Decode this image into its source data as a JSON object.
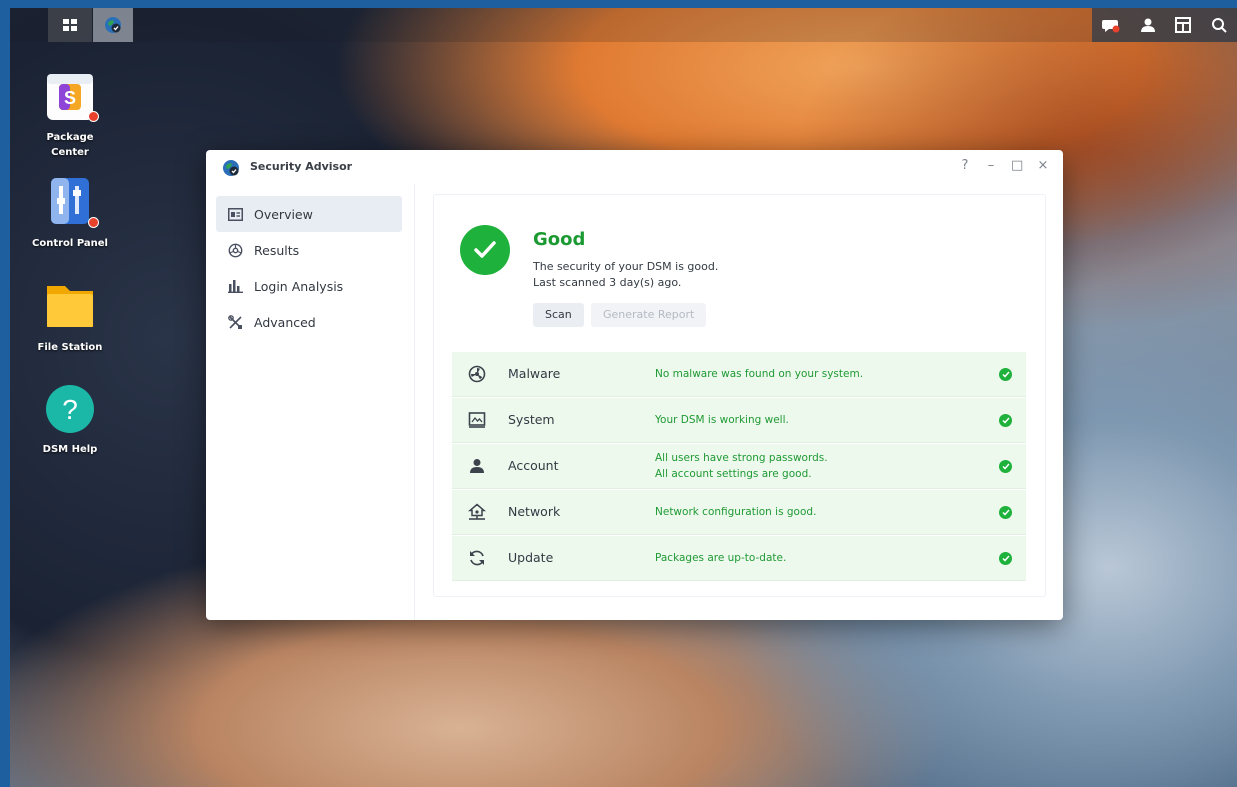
{
  "desktop": {
    "icons": [
      {
        "label": "Package\nCenter",
        "icon": "package-center-icon"
      },
      {
        "label": "Control Panel",
        "icon": "control-panel-icon"
      },
      {
        "label": "File Station",
        "icon": "file-station-icon"
      },
      {
        "label": "DSM Help",
        "icon": "dsm-help-icon"
      }
    ]
  },
  "taskbar": {
    "left": [
      "main-menu-icon",
      "security-advisor-taskbar-icon"
    ],
    "right": [
      "notifications-icon",
      "user-icon",
      "widgets-icon",
      "search-icon"
    ]
  },
  "window": {
    "title": "Security Advisor",
    "controls": {
      "help": "?",
      "minimize": "–",
      "maximize": "□",
      "close": "×"
    },
    "sidebar": [
      {
        "label": "Overview",
        "icon": "overview-icon",
        "selected": true
      },
      {
        "label": "Results",
        "icon": "results-icon"
      },
      {
        "label": "Login Analysis",
        "icon": "login-analysis-icon"
      },
      {
        "label": "Advanced",
        "icon": "advanced-icon"
      }
    ],
    "overview": {
      "status": "Good",
      "description": "The security of your DSM is good.",
      "last_scanned": "Last scanned 3 day(s) ago.",
      "scan_button": "Scan",
      "report_button": "Generate Report",
      "categories": [
        {
          "name": "Malware",
          "icon": "malware-icon",
          "message": "No malware was found on your system."
        },
        {
          "name": "System",
          "icon": "system-icon",
          "message": "Your DSM is working well."
        },
        {
          "name": "Account",
          "icon": "account-icon",
          "message": "All users have strong passwords.",
          "message2": "All account settings are good."
        },
        {
          "name": "Network",
          "icon": "network-icon",
          "message": "Network configuration is good."
        },
        {
          "name": "Update",
          "icon": "update-icon",
          "message": "Packages are up-to-date."
        }
      ]
    }
  },
  "colors": {
    "accent_green": "#1eb13b",
    "row_bg": "#eef9ee",
    "selected_nav": "#e8edf3"
  }
}
